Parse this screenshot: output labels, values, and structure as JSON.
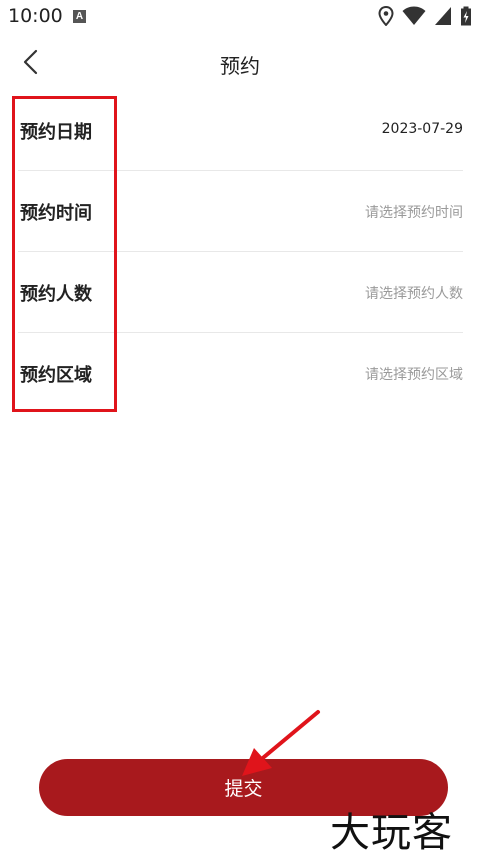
{
  "status_bar": {
    "time": "10:00",
    "notification_badge": "A",
    "icons": [
      "location-icon",
      "wifi-icon",
      "cell-signal-icon",
      "battery-icon"
    ]
  },
  "header": {
    "title": "预约",
    "back_icon": "chevron-left-icon"
  },
  "form": {
    "rows": [
      {
        "label": "预约日期",
        "value": "2023-07-29",
        "placeholder": false
      },
      {
        "label": "预约时间",
        "value": "请选择预约时间",
        "placeholder": true
      },
      {
        "label": "预约人数",
        "value": "请选择预约人数",
        "placeholder": true
      },
      {
        "label": "预约区域",
        "value": "请选择预约区域",
        "placeholder": true
      }
    ]
  },
  "submit": {
    "label": "提交"
  },
  "colors": {
    "accent": "#a8191d",
    "annotation_red": "#e0141b",
    "placeholder_text": "#9a9a9a"
  },
  "watermark": {
    "text": "大玩客"
  }
}
